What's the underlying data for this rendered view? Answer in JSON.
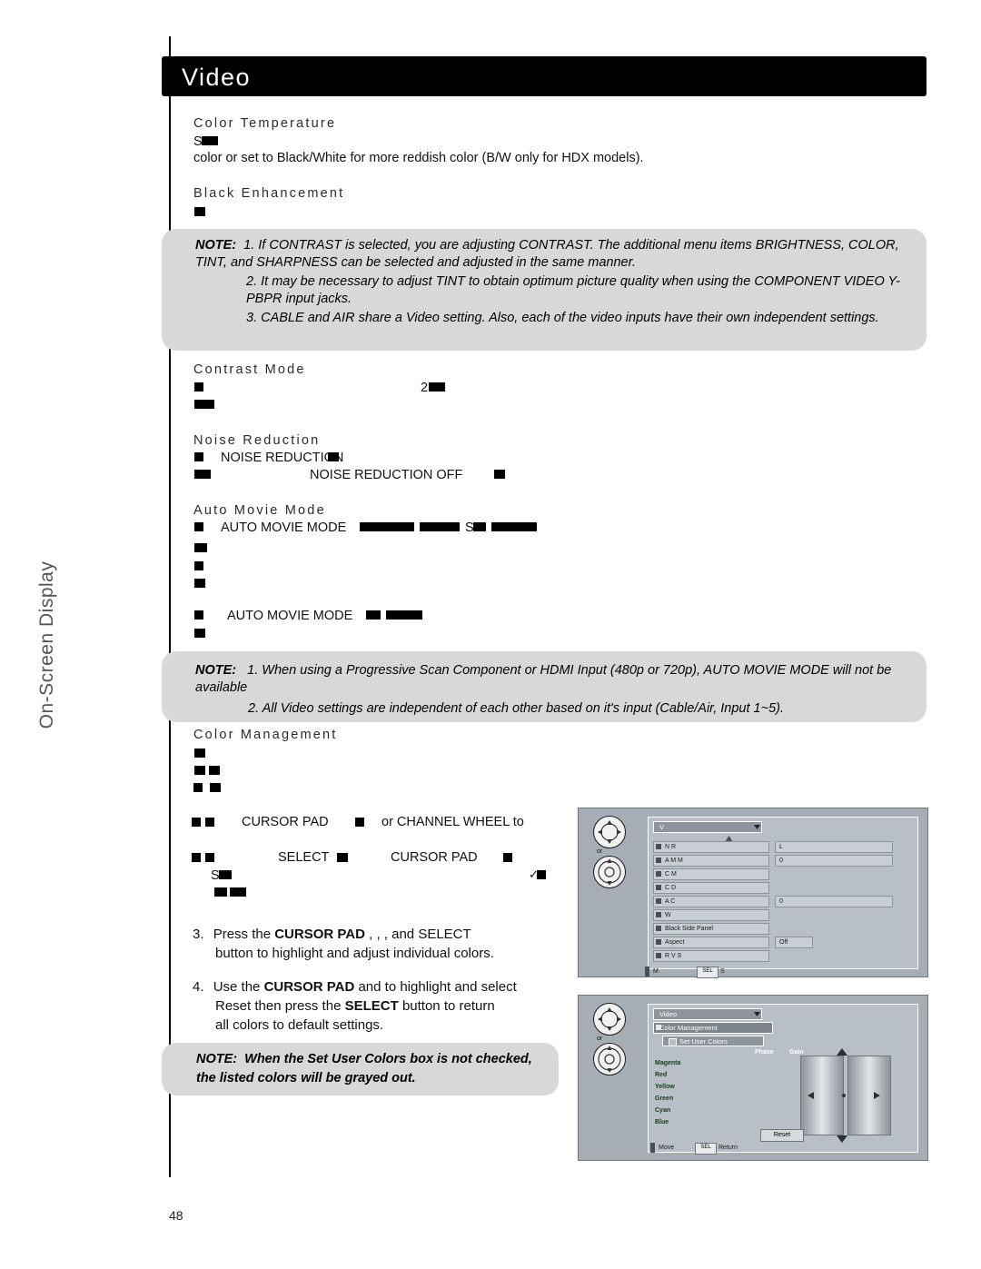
{
  "page": {
    "number": "48",
    "sidebar_tab": "On-Screen Display",
    "header_title": "Video"
  },
  "sections": [
    {
      "id": "color_temperature",
      "heading": "Color Temperature",
      "lines": [
        "color or set to Black/White for more reddish color (B/W only for HDX models)."
      ]
    },
    {
      "id": "black_enhancement",
      "heading": "Black Enhancement",
      "lines": []
    },
    {
      "id": "contrast_mode",
      "heading": "Contrast Mode",
      "lines": []
    },
    {
      "id": "noise_reduction",
      "heading": "Noise Reduction",
      "lines": [
        "NOISE REDUCTION",
        "NOISE REDUCTION   OFF"
      ]
    },
    {
      "id": "auto_movie_mode",
      "heading": "Auto Movie Mode",
      "lines": [
        "AUTO MOVIE MODE",
        "AUTO MOVIE MODE"
      ]
    },
    {
      "id": "color_management",
      "heading": "Color Management",
      "lines": []
    }
  ],
  "fragments": {
    "noise_reduction_1": "NOISE REDUCTION",
    "noise_reduction_2": "NOISE REDUCTION     OFF",
    "auto_movie_1": "AUTO MOVIE MODE",
    "auto_movie_2": "AUTO MOVIE MODE",
    "cursor_pad_line": "CURSOR PAD",
    "or_channel_wheel": "or  CHANNEL  WHEEL  to",
    "select_line": "SELECT",
    "cursor_pad_2": "CURSOR PAD"
  },
  "notes": [
    {
      "id": "note-1",
      "label": "NOTE:",
      "items": [
        "1.  If CONTRAST is selected, you are adjusting CONTRAST. The additional menu items BRIGHTNESS, COLOR, TINT, and SHARPNESS can be selected and adjusted in the same manner.",
        "2.  It may be necessary to adjust TINT to obtain optimum picture quality when using the COMPONENT VIDEO Y-PBPR input jacks.",
        "3.  CABLE and AIR share a Video setting. Also, each of the video inputs have their own independent settings."
      ]
    },
    {
      "id": "note-2",
      "label": "NOTE:",
      "items": [
        "1.   When using a Progressive Scan Component or HDMI Input (480p or 720p), AUTO MOVIE MODE will not be available",
        "2.   All Video settings are independent of each other based on it's input (Cable/Air, Input 1~5)."
      ]
    },
    {
      "id": "note-3",
      "label": "NOTE:",
      "items": [
        "When the Set User Colors box is not checked, the listed colors will be grayed out."
      ]
    }
  ],
  "steps": [
    {
      "num": "3.",
      "line1_pre": "Press  the ",
      "line1_bold": "CURSOR PAD",
      "line1_post": "  ,    ,    ,    and SELECT",
      "line2": "button to highlight and adjust individual colors."
    },
    {
      "num": "4.",
      "line1_pre": "Use  the ",
      "line1_bold": "CURSOR PAD",
      "line1_post": "    and     to highlight and select",
      "line2_pre": " Reset  then press the ",
      "line2_bold": "SELECT",
      "line2_post": " button to return",
      "line3": "all colors to default settings."
    }
  ],
  "osd_video": {
    "title": "V",
    "rows": [
      {
        "label": "N R",
        "value": "L"
      },
      {
        "label": "A M M",
        "value": "0"
      },
      {
        "label": "C M",
        "value": ""
      },
      {
        "label": "C D",
        "value": ""
      },
      {
        "label": "A C",
        "value": "0"
      },
      {
        "label": "W",
        "value": ""
      },
      {
        "label": "Black Side Panel",
        "value": ""
      },
      {
        "label": "Aspect",
        "value": "Off"
      },
      {
        "label": "R V S",
        "value": ""
      }
    ],
    "footer_move": "M",
    "footer_sel": "SEL",
    "footer_select": "S",
    "or_label": "or"
  },
  "osd_color_management": {
    "title": "Video",
    "menu_item": "Color Management",
    "checkbox_label": "Set User Colors",
    "col_phase": "Phase",
    "col_gain": "Gain",
    "colors": [
      "Magenta",
      "Red",
      "Yellow",
      "Green",
      "Cyan",
      "Blue"
    ],
    "reset_label": "Reset",
    "footer_move": "Move",
    "footer_sel": "SEL",
    "footer_return": "Return",
    "or_label": "or"
  },
  "colors": {
    "header_bg": "#000000",
    "note_bg": "#d8d8d8",
    "osd_bg": "#a7adb5",
    "osd_panel": "#b9bfc6",
    "osd_row": "#c9ced4",
    "osd_title": "#8e949c"
  }
}
